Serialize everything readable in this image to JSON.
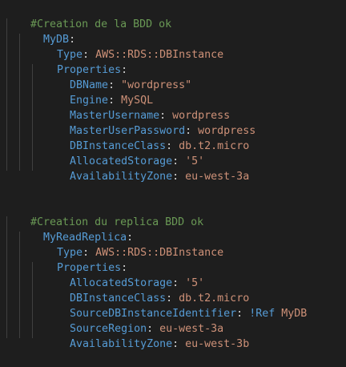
{
  "blocks": [
    {
      "comment": "#Creation de la BDD ok",
      "resource": "MyDB",
      "type_key": "Type",
      "type_value": "AWS::RDS::DBInstance",
      "props_key": "Properties",
      "props": [
        {
          "key": "DBName",
          "value": "\"wordpress\""
        },
        {
          "key": "Engine",
          "value": "MySQL"
        },
        {
          "key": "MasterUsername",
          "value": "wordpress"
        },
        {
          "key": "MasterUserPassword",
          "value": "wordpress"
        },
        {
          "key": "DBInstanceClass",
          "value": "db.t2.micro"
        },
        {
          "key": "AllocatedStorage",
          "value": "'5'"
        },
        {
          "key": "AvailabilityZone",
          "value": "eu-west-3a"
        }
      ]
    },
    {
      "comment": "#Creation du replica BDD ok",
      "resource": "MyReadReplica",
      "type_key": "Type",
      "type_value": "AWS::RDS::DBInstance",
      "props_key": "Properties",
      "props": [
        {
          "key": "AllocatedStorage",
          "value": "'5'"
        },
        {
          "key": "DBInstanceClass",
          "value": "db.t2.micro"
        },
        {
          "key": "SourceDBInstanceIdentifier",
          "tag": "!Ref",
          "value": "MyDB"
        },
        {
          "key": "SourceRegion",
          "value": "eu-west-3a"
        },
        {
          "key": "AvailabilityZone",
          "value": "eu-west-3b"
        }
      ]
    }
  ],
  "colors": {
    "background": "#1e1e1e",
    "comment": "#6a9955",
    "key": "#569cd6",
    "string": "#ce9178",
    "punctuation": "#d4d4d4"
  }
}
